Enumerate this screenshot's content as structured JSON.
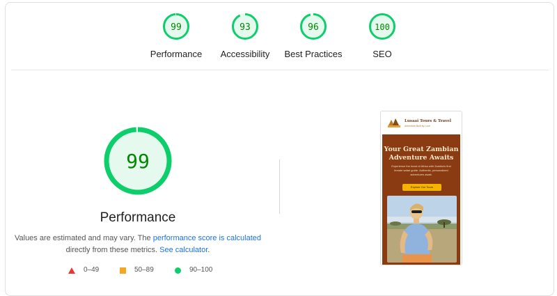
{
  "scores": [
    {
      "value": "99",
      "label": "Performance",
      "score": 99
    },
    {
      "value": "93",
      "label": "Accessibility",
      "score": 93
    },
    {
      "value": "96",
      "label": "Best Practices",
      "score": 96
    },
    {
      "value": "100",
      "label": "SEO",
      "score": 100
    }
  ],
  "main": {
    "score": "99",
    "title": "Performance",
    "desc_prefix": "Values are estimated and may vary. The ",
    "desc_link": "performance score is calculated",
    "desc_mid": "directly from these metrics. ",
    "desc_calc": "See calculator",
    "desc_end": "."
  },
  "legend": {
    "fail": "0–49",
    "average": "50–89",
    "pass": "90–100"
  },
  "preview": {
    "brand": "Lusaai Tours & Travel",
    "brand_sub": "Adventure Built by Love",
    "hero_title": "Your Great Zambian Adventure Awaits",
    "hero_sub": "Experience the heart of Africa with Zambia's first female safari guide. Authentic, personalized adventures await.",
    "cta": "Explore Our Tours"
  },
  "colors": {
    "pass": "#0cce6b",
    "pass_text": "#008800",
    "pass_bg": "#e6f9ee",
    "average": "#f5a623",
    "fail": "#e53935",
    "link": "#1a73e8",
    "hero_bg": "#8a3b12",
    "cta_bg": "#f4b400"
  }
}
